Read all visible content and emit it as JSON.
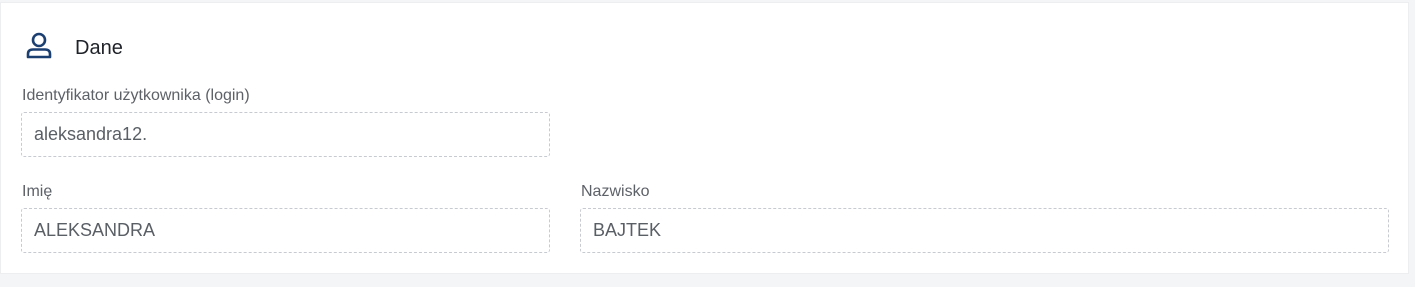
{
  "section": {
    "title": "Dane",
    "icon": "user-icon",
    "accent_color": "#1c3f72"
  },
  "fields": {
    "login": {
      "label": "Identyfikator użytkownika (login)",
      "value": "aleksandra12."
    },
    "first_name": {
      "label": "Imię",
      "value": "ALEKSANDRA"
    },
    "last_name": {
      "label": "Nazwisko",
      "value": "BAJTEK"
    }
  }
}
